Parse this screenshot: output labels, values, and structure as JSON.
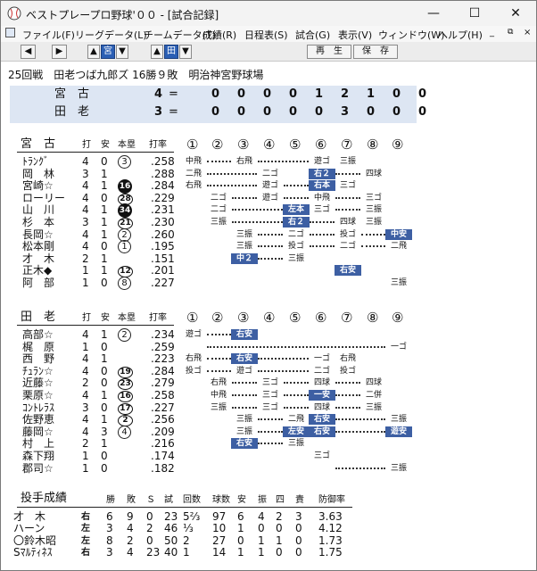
{
  "window": {
    "title": "ベストプレープロ野球'００ - [試合記録]",
    "min": "—",
    "max": "☐",
    "close": "✕"
  },
  "menu": [
    "ファイル(F)",
    "リーグデータ(L)",
    "チームデータ(T)",
    "成績(R)",
    "日程表(S)",
    "試合(G)",
    "表示(V)",
    "ウィンドウ(W)",
    "ヘルプ(H)"
  ],
  "toolbar": {
    "team1": "宮",
    "team2": "田",
    "play": "再　生",
    "save": "保　存"
  },
  "game": {
    "info": "25回戦　田老つば九郎ズ 16勝９敗　明治神宮野球場"
  },
  "score": [
    {
      "team": "宮　古",
      "runs": "4",
      "eq": "=",
      "inn": [
        "0",
        "0",
        "0",
        "0",
        "1",
        "2",
        "1",
        "0",
        "0"
      ]
    },
    {
      "team": "田　老",
      "runs": "3",
      "eq": "=",
      "inn": [
        "0",
        "0",
        "0",
        "0",
        "0",
        "3",
        "0",
        "0",
        "0"
      ]
    }
  ],
  "headers": {
    "ab": "打",
    "h": "安",
    "hr": "本塁",
    "avg": "打率",
    "inn": [
      "①",
      "②",
      "③",
      "④",
      "⑤",
      "⑥",
      "⑦",
      "⑧",
      "⑨"
    ]
  },
  "teams": [
    {
      "name": "宮　古",
      "players": [
        {
          "name": "ﾄﾗﾝｸﾞ",
          "ab": "4",
          "h": "0",
          "hr": "3",
          "hrs": "c",
          "avg": ".258",
          "res": [
            "中飛",
            "",
            "右飛",
            "",
            "",
            "遊ゴ",
            "三振",
            "",
            ""
          ],
          "dots": [
            [
              0,
              2
            ],
            [
              2,
              5
            ]
          ],
          "hits": []
        },
        {
          "name": "岡　林",
          "ab": "3",
          "h": "1",
          "hr": "",
          "hrs": "",
          "avg": ".288",
          "res": [
            "二飛",
            "",
            "",
            "二ゴ",
            "",
            "右２",
            "",
            "四球",
            ""
          ],
          "dots": [
            [
              0,
              3
            ],
            [
              5,
              7
            ]
          ],
          "hits": [
            5
          ]
        },
        {
          "name": "宮崎☆",
          "ab": "4",
          "h": "1",
          "hr": "16",
          "hrs": "f",
          "avg": ".284",
          "res": [
            "右飛",
            "",
            "",
            "遊ゴ",
            "",
            "右本",
            "三ゴ",
            "",
            ""
          ],
          "dots": [
            [
              0,
              3
            ],
            [
              3,
              5
            ]
          ],
          "hits": [
            5
          ]
        },
        {
          "name": "ローリー",
          "ab": "4",
          "h": "0",
          "hr": "28",
          "hrs": "o",
          "avg": ".229",
          "res": [
            "",
            "二ゴ",
            "",
            "遊ゴ",
            "",
            "中飛",
            "",
            "三ゴ",
            ""
          ],
          "dots": [
            [
              1,
              3
            ],
            [
              3,
              5
            ],
            [
              5,
              7
            ]
          ],
          "hits": []
        },
        {
          "name": "山　川",
          "ab": "4",
          "h": "1",
          "hr": "34",
          "hrs": "f",
          "avg": ".231",
          "res": [
            "",
            "二ゴ",
            "",
            "",
            "左本",
            "三ゴ",
            "",
            "三振",
            ""
          ],
          "dots": [
            [
              1,
              4
            ],
            [
              5,
              7
            ]
          ],
          "hits": [
            4
          ]
        },
        {
          "name": "杉　本",
          "ab": "3",
          "h": "1",
          "hr": "21",
          "hrs": "o",
          "avg": ".230",
          "res": [
            "",
            "三振",
            "",
            "",
            "右２",
            "",
            "四球",
            "三振",
            ""
          ],
          "dots": [
            [
              1,
              4
            ],
            [
              4,
              6
            ]
          ],
          "hits": [
            4
          ]
        },
        {
          "name": "長岡☆",
          "ab": "4",
          "h": "1",
          "hr": "2",
          "hrs": "c",
          "avg": ".260",
          "res": [
            "",
            "",
            "三振",
            "",
            "二ゴ",
            "",
            "投ゴ",
            "",
            "中安"
          ],
          "dots": [
            [
              2,
              4
            ],
            [
              4,
              6
            ],
            [
              6,
              8
            ]
          ],
          "hits": [
            8
          ]
        },
        {
          "name": "松本剛",
          "ab": "4",
          "h": "0",
          "hr": "1",
          "hrs": "c",
          "avg": ".195",
          "res": [
            "",
            "",
            "三振",
            "",
            "投ゴ",
            "",
            "二ゴ",
            "",
            "二飛"
          ],
          "dots": [
            [
              2,
              4
            ],
            [
              4,
              6
            ],
            [
              6,
              8
            ]
          ],
          "hits": []
        },
        {
          "name": "才　木",
          "ab": "2",
          "h": "1",
          "hr": "",
          "hrs": "",
          "avg": ".151",
          "res": [
            "",
            "",
            "中２",
            "",
            "三振",
            "",
            "",
            "",
            ""
          ],
          "dots": [
            [
              2,
              4
            ]
          ],
          "hits": [
            2
          ]
        },
        {
          "name": "正木◆",
          "ab": "1",
          "h": "1",
          "hr": "12",
          "hrs": "o",
          "avg": ".201",
          "res": [
            "",
            "",
            "",
            "",
            "",
            "",
            "右安",
            "",
            ""
          ],
          "dots": [],
          "hits": [
            6
          ]
        },
        {
          "name": "阿　部",
          "ab": "1",
          "h": "0",
          "hr": "8",
          "hrs": "c",
          "avg": ".227",
          "res": [
            "",
            "",
            "",
            "",
            "",
            "",
            "",
            "",
            "三振"
          ],
          "dots": [],
          "hits": []
        }
      ]
    },
    {
      "name": "田　老",
      "players": [
        {
          "name": "高部☆",
          "ab": "4",
          "h": "1",
          "hr": "2",
          "hrs": "c",
          "avg": ".234",
          "res": [
            "遊ゴ",
            "",
            "右安",
            "",
            "",
            "",
            "",
            "",
            ""
          ],
          "dots": [
            [
              0,
              2
            ],
            [
              2,
              9
            ]
          ],
          "hits": [
            2
          ]
        },
        {
          "name": "梶　原",
          "ab": "1",
          "h": "0",
          "hr": "",
          "hrs": "",
          "avg": ".259",
          "res": [
            "",
            "",
            "",
            "",
            "",
            "",
            "",
            "",
            "一ゴ"
          ],
          "dots": [
            [
              0,
              8
            ]
          ],
          "hits": []
        },
        {
          "name": "西　野",
          "ab": "4",
          "h": "1",
          "hr": "",
          "hrs": "",
          "avg": ".223",
          "res": [
            "右飛",
            "",
            "右安",
            "",
            "",
            "一ゴ",
            "右飛",
            "",
            ""
          ],
          "dots": [
            [
              0,
              2
            ],
            [
              2,
              5
            ]
          ],
          "hits": [
            2
          ]
        },
        {
          "name": "ﾁｭﾗﾝ☆",
          "ab": "4",
          "h": "0",
          "hr": "19",
          "hrs": "o",
          "avg": ".284",
          "res": [
            "投ゴ",
            "",
            "遊ゴ",
            "",
            "",
            "二ゴ",
            "投ゴ",
            "",
            ""
          ],
          "dots": [
            [
              0,
              2
            ],
            [
              2,
              5
            ]
          ],
          "hits": []
        },
        {
          "name": "近藤☆",
          "ab": "2",
          "h": "0",
          "hr": "23",
          "hrs": "o",
          "avg": ".279",
          "res": [
            "",
            "右飛",
            "",
            "三ゴ",
            "",
            "四球",
            "",
            "四球",
            ""
          ],
          "dots": [
            [
              1,
              3
            ],
            [
              3,
              5
            ],
            [
              5,
              7
            ]
          ],
          "hits": []
        },
        {
          "name": "栗原☆",
          "ab": "4",
          "h": "1",
          "hr": "16",
          "hrs": "o",
          "avg": ".258",
          "res": [
            "",
            "中飛",
            "",
            "三ゴ",
            "",
            "一安",
            "",
            "二併",
            ""
          ],
          "dots": [
            [
              1,
              3
            ],
            [
              3,
              5
            ],
            [
              5,
              7
            ]
          ],
          "hits": [
            5
          ]
        },
        {
          "name": "ｺﾝﾄﾚﾗｽ",
          "ab": "3",
          "h": "0",
          "hr": "17",
          "hrs": "o",
          "avg": ".227",
          "res": [
            "",
            "三振",
            "",
            "三ゴ",
            "",
            "四球",
            "",
            "三振",
            ""
          ],
          "dots": [
            [
              1,
              3
            ],
            [
              3,
              5
            ],
            [
              5,
              7
            ]
          ],
          "hits": []
        },
        {
          "name": "佐野恵",
          "ab": "4",
          "h": "1",
          "hr": "2",
          "hrs": "o",
          "avg": ".256",
          "res": [
            "",
            "",
            "三振",
            "",
            "二飛",
            "右安",
            "",
            "",
            "三振"
          ],
          "dots": [
            [
              2,
              4
            ],
            [
              5,
              8
            ]
          ],
          "hits": [
            5
          ]
        },
        {
          "name": "藤岡☆",
          "ab": "4",
          "h": "3",
          "hr": "4",
          "hrs": "c",
          "avg": ".209",
          "res": [
            "",
            "",
            "三振",
            "",
            "左安",
            "右安",
            "",
            "",
            "遊安"
          ],
          "dots": [
            [
              2,
              4
            ],
            [
              5,
              8
            ]
          ],
          "hits": [
            4,
            5,
            8
          ]
        },
        {
          "name": "村　上",
          "ab": "2",
          "h": "1",
          "hr": "",
          "hrs": "",
          "avg": ".216",
          "res": [
            "",
            "",
            "右安",
            "",
            "三振",
            "",
            "",
            "",
            ""
          ],
          "dots": [
            [
              2,
              4
            ]
          ],
          "hits": [
            2
          ]
        },
        {
          "name": "森下翔",
          "ab": "1",
          "h": "0",
          "hr": "",
          "hrs": "",
          "avg": ".174",
          "res": [
            "",
            "",
            "",
            "",
            "",
            "三ゴ",
            "",
            "",
            ""
          ],
          "dots": [],
          "hits": []
        },
        {
          "name": "郡司☆",
          "ab": "1",
          "h": "0",
          "hr": "",
          "hrs": "",
          "avg": ".182",
          "res": [
            "",
            "",
            "",
            "",
            "",
            "",
            "",
            "",
            "三振"
          ],
          "dots": [
            [
              5,
              8
            ]
          ],
          "hits": []
        }
      ]
    }
  ],
  "pitching": {
    "title": "投手成績",
    "headers": [
      "勝",
      "敗",
      "Ｓ",
      "試",
      "回数",
      "球数",
      "安",
      "振",
      "四",
      "責",
      "防御率"
    ],
    "rows": [
      {
        "name": "才　木",
        "hand": "右",
        "w": "6",
        "l": "9",
        "s": "0",
        "g": "23",
        "ip": "5⅔",
        "pc": "97",
        "h": "6",
        "k": "4",
        "bb": "2",
        "er": "3",
        "era": "3.63"
      },
      {
        "name": "ハーン",
        "hand": "左",
        "w": "3",
        "l": "4",
        "s": "2",
        "g": "46",
        "ip": "⅓",
        "pc": "10",
        "h": "1",
        "k": "0",
        "bb": "0",
        "er": "0",
        "era": "4.12"
      },
      {
        "name": "〇鈴木昭",
        "hand": "左",
        "w": "8",
        "l": "2",
        "s": "0",
        "g": "50",
        "ip": "2",
        "pc": "27",
        "h": "0",
        "k": "1",
        "bb": "1",
        "er": "0",
        "era": "1.73"
      },
      {
        "name": "Sﾏﾙﾃｨﾈｽ",
        "hand": "右",
        "w": "3",
        "l": "4",
        "s": "23",
        "g": "40",
        "ip": "1",
        "pc": "14",
        "h": "1",
        "k": "1",
        "bb": "0",
        "er": "0",
        "era": "1.75"
      }
    ]
  }
}
